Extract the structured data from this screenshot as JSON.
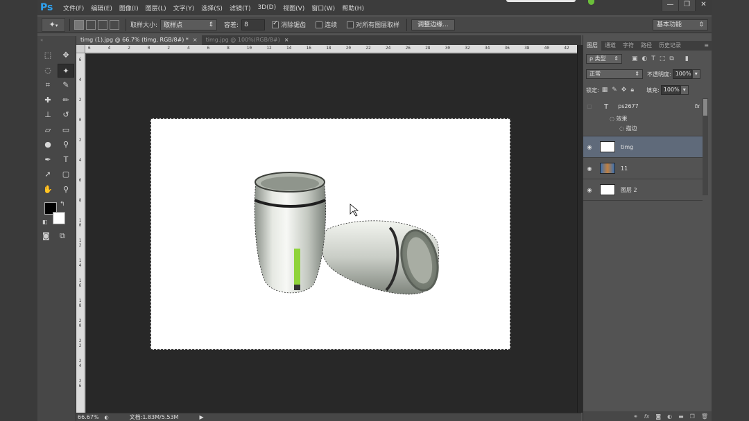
{
  "app": {
    "logo": "Ps",
    "menu": [
      "文件(F)",
      "编辑(E)",
      "图像(I)",
      "图层(L)",
      "文字(Y)",
      "选择(S)",
      "滤镜(T)",
      "3D(D)",
      "视图(V)",
      "窗口(W)",
      "帮助(H)"
    ],
    "window_buttons": [
      "—",
      "❐",
      "✕"
    ]
  },
  "options_bar": {
    "tool_icon": "magic-wand-icon",
    "tool_glyph": "✦",
    "sample_size_label": "取样大小:",
    "sample_size_value": "取样点",
    "tolerance_label": "容差:",
    "tolerance_value": "8",
    "antialias_label": "消除锯齿",
    "antialias_checked": true,
    "contiguous_label": "连续",
    "contiguous_checked": false,
    "sample_all_label": "对所有图层取样",
    "sample_all_checked": false,
    "refine_edge_label": "调整边缘...",
    "workspace_value": "基本功能"
  },
  "doc_tabs": [
    {
      "label": "timg (1).jpg @ 66.7% (timg, RGB/8#) *",
      "active": true
    },
    {
      "label": "timg.jpg @ 100%(RGB/8#)",
      "active": false
    }
  ],
  "rulers": {
    "horizontal": [
      "6",
      "4",
      "2",
      "0",
      "2",
      "4",
      "6",
      "8",
      "10",
      "12",
      "14",
      "16",
      "18",
      "20",
      "22",
      "24",
      "26",
      "28",
      "30",
      "32",
      "34",
      "36",
      "38",
      "40",
      "42"
    ],
    "vertical": [
      "6",
      "4",
      "2",
      "0",
      "2",
      "4",
      "6",
      "8",
      "1 0",
      "1 2",
      "1 4",
      "1 6",
      "1 8",
      "2 0",
      "2 2",
      "2 4",
      "2 6"
    ]
  },
  "status_bar": {
    "zoom": "66.67%",
    "doc_info": "文档:1.83M/5.53M",
    "arrow": "▶"
  },
  "layers_panel": {
    "tabs": [
      "图层",
      "通道",
      "字符",
      "路径",
      "历史记录"
    ],
    "filter_kind": "ρ 类型",
    "blend_mode": "正常",
    "opacity_label": "不透明度:",
    "opacity_value": "100%",
    "lock_label": "锁定:",
    "fill_label": "填充:",
    "fill_value": "100%",
    "layers": [
      {
        "name": "ps2677",
        "type": "text",
        "visible": false,
        "fx": "fx",
        "effects_label": "效果",
        "effect_item": "描边"
      },
      {
        "name": "timg",
        "type": "image",
        "visible": true,
        "selected": true
      },
      {
        "name": "11",
        "type": "image",
        "visible": true
      },
      {
        "name": "图层 2",
        "type": "fill",
        "visible": true
      }
    ],
    "footer_icons": [
      "link-icon",
      "fx-icon",
      "mask-icon",
      "adjustment-icon",
      "group-icon",
      "new-layer-icon",
      "trash-icon"
    ]
  },
  "colors": {
    "accent_logo": "#2fa3f2",
    "canvas_bg": "#282828",
    "selected_layer": "#5f6a7a",
    "brand_green": "#8fd33a"
  }
}
